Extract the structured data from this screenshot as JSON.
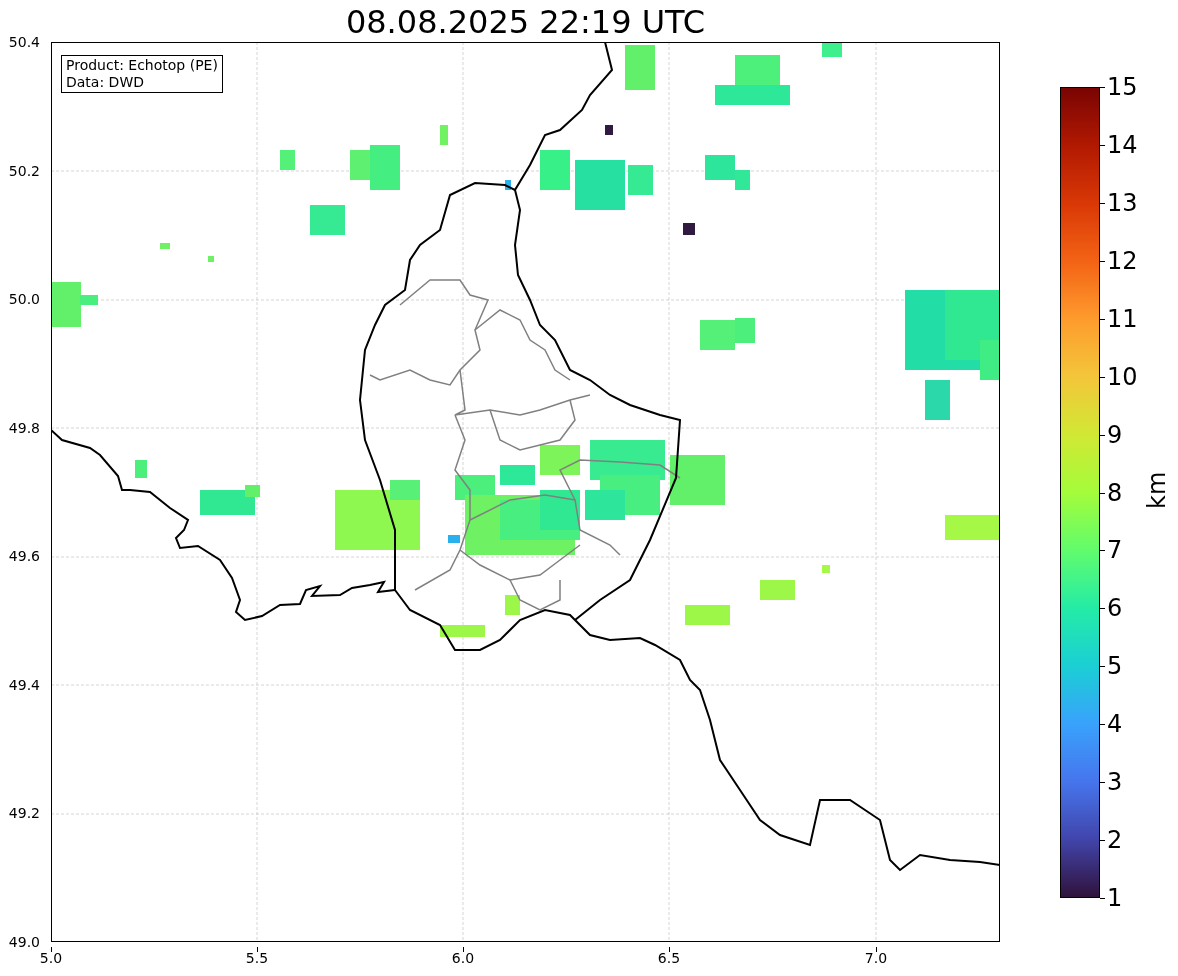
{
  "title": "08.08.2025 22:19 UTC",
  "info_box": [
    "Product: Echotop (PE)",
    "Data: DWD"
  ],
  "x_axis": {
    "ticks": [
      "5.0",
      "5.5",
      "6.0",
      "6.5",
      "7.0"
    ]
  },
  "y_axis": {
    "ticks": [
      "50.4",
      "50.2",
      "50.0",
      "49.8",
      "49.6",
      "49.4",
      "49.2",
      "49.0"
    ]
  },
  "colorbar": {
    "label": "km",
    "ticks": [
      "15",
      "14",
      "13",
      "12",
      "11",
      "10",
      "9",
      "8",
      "7",
      "6",
      "5",
      "4",
      "3",
      "2",
      "1"
    ]
  }
}
